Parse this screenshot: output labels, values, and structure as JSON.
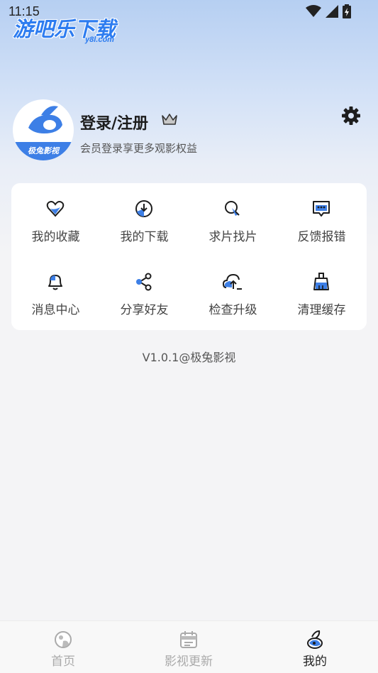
{
  "status_bar": {
    "time": "11:15"
  },
  "watermark": {
    "main": "游吧乐下载",
    "sub": "y8l.com"
  },
  "profile": {
    "login_title": "登录/注册",
    "login_subtitle": "会员登录享更多观影权益",
    "avatar_text": "极兔影视"
  },
  "menu": {
    "items": [
      {
        "label": "我的收藏",
        "icon": "heart-icon"
      },
      {
        "label": "我的下载",
        "icon": "download-icon"
      },
      {
        "label": "求片找片",
        "icon": "search-icon"
      },
      {
        "label": "反馈报错",
        "icon": "feedback-icon"
      },
      {
        "label": "消息中心",
        "icon": "bell-icon"
      },
      {
        "label": "分享好友",
        "icon": "share-icon"
      },
      {
        "label": "检查升级",
        "icon": "upgrade-icon"
      },
      {
        "label": "清理缓存",
        "icon": "broom-icon"
      }
    ]
  },
  "version": "V1.0.1@极兔影视",
  "bottom_nav": {
    "items": [
      {
        "label": "首页",
        "icon": "home-icon",
        "active": false
      },
      {
        "label": "影视更新",
        "icon": "calendar-icon",
        "active": false
      },
      {
        "label": "我的",
        "icon": "profile-icon",
        "active": true
      }
    ]
  },
  "colors": {
    "accent": "#3d7fe6",
    "text_dark": "#1d1d1d",
    "background": "#f4f4f6"
  }
}
